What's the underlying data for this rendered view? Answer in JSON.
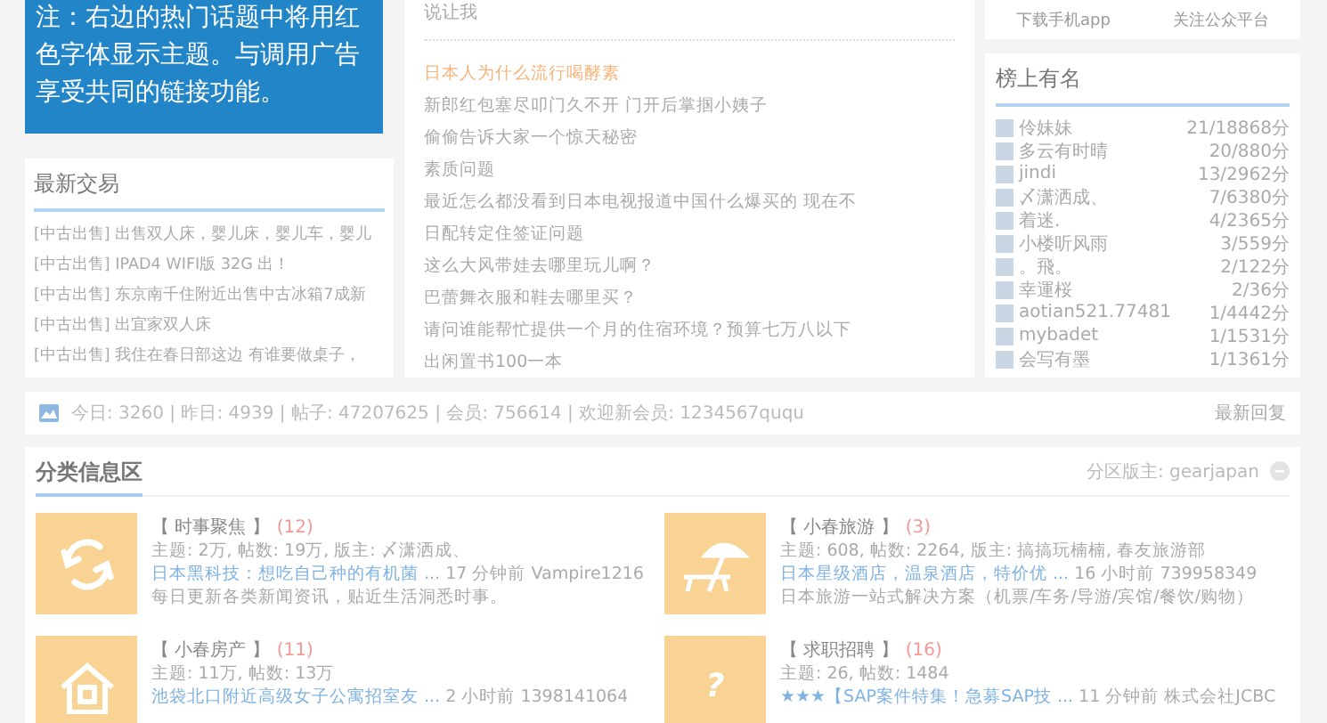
{
  "notice": {
    "text": "注：右边的热门话题中将用红色字体显示主题。与调用广告享受共同的链接功能。"
  },
  "latest_trades": {
    "title": "最新交易",
    "items": [
      {
        "tag": "[中古出售]",
        "text": "出售双人床，婴儿床，婴儿车，婴儿"
      },
      {
        "tag": "[中古出售]",
        "text": "IPAD4 WIFI版 32G 出！"
      },
      {
        "tag": "[中古出售]",
        "text": "东京南千住附近出售中古冰箱7成新"
      },
      {
        "tag": "[中古出售]",
        "text": "出宜家双人床"
      },
      {
        "tag": "[中古出售]",
        "text": "我住在春日部这边 有谁要做桌子，"
      }
    ]
  },
  "hot_topics": {
    "intro": "说让我",
    "items": [
      {
        "text": "日本人为什么流行喝酵素",
        "highlighted": true
      },
      {
        "text": "新郎红包塞尽叩门久不开 门开后掌掴小姨子",
        "highlighted": false
      },
      {
        "text": "偷偷告诉大家一个惊天秘密",
        "highlighted": false
      },
      {
        "text": "素质问题",
        "highlighted": false
      },
      {
        "text": "最近怎么都没看到日本电视报道中国什么爆买的 现在不",
        "highlighted": false
      },
      {
        "text": "日配转定住签证问题",
        "highlighted": false
      },
      {
        "text": "这么大风带娃去哪里玩儿啊？",
        "highlighted": false
      },
      {
        "text": "巴蕾舞衣服和鞋去哪里买？",
        "highlighted": false
      },
      {
        "text": "请问谁能帮忙提供一个月的住宿环境？预算七万八以下",
        "highlighted": false
      },
      {
        "text": "出闲置书100一本",
        "highlighted": false
      }
    ]
  },
  "app_links": [
    "下载手机app",
    "关注公众平台"
  ],
  "ranking": {
    "title": "榜上有名",
    "rows": [
      {
        "name": "伶妹妹",
        "score": "21/18868分"
      },
      {
        "name": "多云有时晴",
        "score": "20/880分"
      },
      {
        "name": "jindi",
        "score": "13/2962分"
      },
      {
        "name": "〆潇洒成、",
        "score": "7/6380分"
      },
      {
        "name": "着迷.",
        "score": "4/2365分"
      },
      {
        "name": "小楼听风雨",
        "score": "3/559分"
      },
      {
        "name": "。飛。",
        "score": "2/122分"
      },
      {
        "name": "幸運桜",
        "score": "2/36分"
      },
      {
        "name": "aotian521.77481",
        "score": "1/4442分"
      },
      {
        "name": "mybadet",
        "score": "1/1531分"
      },
      {
        "name": "会写有墨",
        "score": "1/1361分"
      }
    ]
  },
  "stats_bar": {
    "text": "今日: 3260 | 昨日: 4939 | 帖子: 47207625 | 会员: 756614 | 欢迎新会员: 1234567ququ",
    "link": "最新回复"
  },
  "category_section": {
    "title": "分类信息区",
    "moderator": "分区版主: gearjapan",
    "forums": [
      {
        "kind": "exchange",
        "name": "【 时事聚焦 】",
        "count": "(12)",
        "stats": "主题: 2万, 帖数: 19万, 版主: 〆潇洒成、",
        "latest_link": "日本黑科技：想吃自己种的有机菌 ...",
        "latest_meta": "17 分钟前 Vampire1216",
        "description": "每日更新各类新闻资讯，贴近生活洞悉时事。"
      },
      {
        "kind": "beach",
        "name": "【 小春旅游 】",
        "count": "(3)",
        "stats": "主题: 608, 帖数: 2264, 版主: 搞搞玩楠楠, 春友旅游部",
        "latest_link": "日本星级酒店，温泉酒店，特价优 ...",
        "latest_meta": "16 小时前 739958349",
        "description": "日本旅游一站式解决方案（机票/车务/导游/宾馆/餐饮/购物）"
      },
      {
        "kind": "house",
        "name": "【 小春房产 】",
        "count": "(11)",
        "stats": "主题: 11万, 帖数: 13万",
        "latest_link": "池袋北口附近高级女子公寓招室友 ...",
        "latest_meta": "2 小时前 1398141064"
      },
      {
        "kind": "job",
        "icon_text": "?",
        "name": "【 求职招聘 】",
        "count": "(16)",
        "stats": "主题: 26, 帖数: 1484",
        "latest_link": "★★★【SAP案件特集！急募SAP技 ...",
        "latest_meta": "11 分钟前 株式会社JCBC"
      }
    ]
  }
}
